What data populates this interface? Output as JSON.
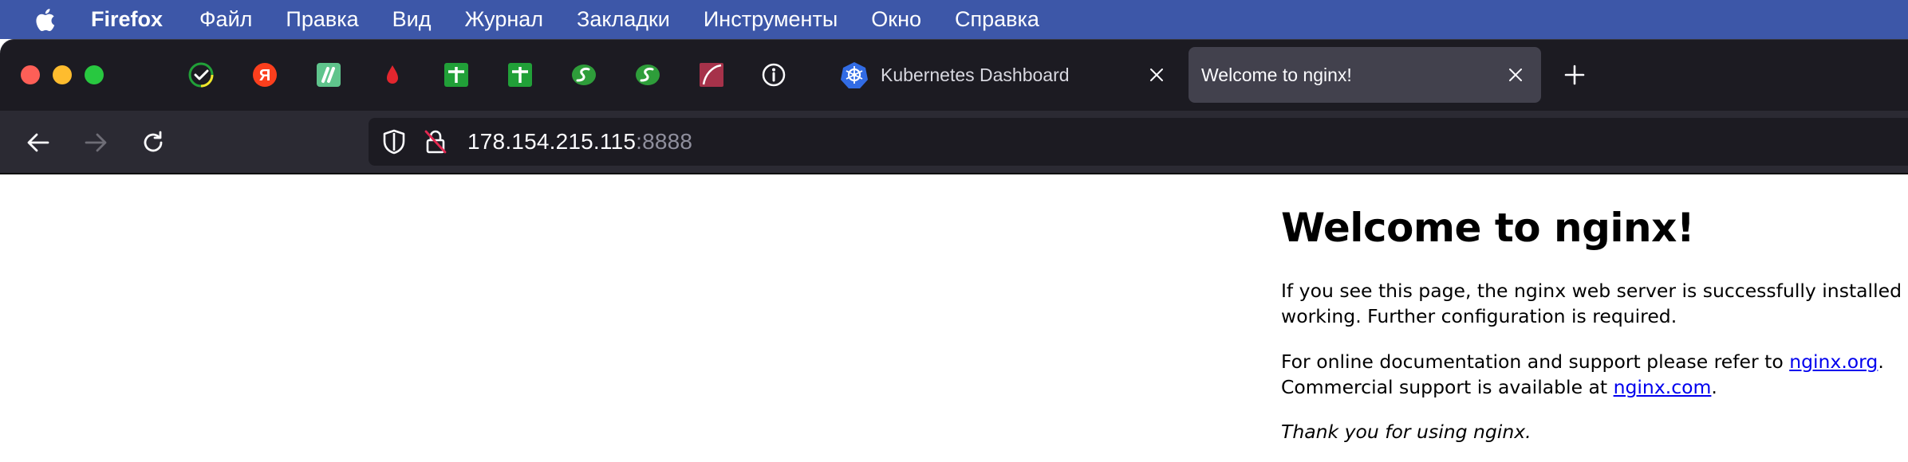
{
  "menubar": {
    "apple_icon": "apple-logo-icon",
    "app_name": "Firefox",
    "items": [
      "Файл",
      "Правка",
      "Вид",
      "Журнал",
      "Закладки",
      "Инструменты",
      "Окно",
      "Справка"
    ]
  },
  "tabbar": {
    "pinned_tabs": [
      {
        "icon": "sber-checkmark-icon",
        "color": "#21a038"
      },
      {
        "icon": "yandex-icon",
        "color": "#fc3f1d"
      },
      {
        "icon": "green-square-app-icon",
        "color": "#5fc48c"
      },
      {
        "icon": "red-drop-icon",
        "color": "#e3262e"
      },
      {
        "icon": "green-table-plus-icon",
        "color": "#21a038"
      },
      {
        "icon": "green-table-plus-icon",
        "color": "#21a038"
      },
      {
        "icon": "green-swirl-s-icon",
        "color": "#2e9d3a"
      },
      {
        "icon": "green-swirl-s-icon",
        "color": "#2e9d3a"
      },
      {
        "icon": "red-feather-icon",
        "color": "#a6324a"
      },
      {
        "icon": "info-circle-icon",
        "color": "#fbfbfe"
      }
    ],
    "tabs": [
      {
        "title": "Kubernetes Dashboard",
        "favicon": "kubernetes-icon",
        "active": false
      },
      {
        "title": "Welcome to nginx!",
        "active": true
      }
    ],
    "new_tab_icon": "plus-icon"
  },
  "navbar": {
    "back_icon": "arrow-left-icon",
    "forward_icon": "arrow-right-icon",
    "reload_icon": "reload-icon",
    "url_host": "178.154.215.115",
    "url_port": ":8888"
  },
  "page": {
    "heading": "Welcome to nginx!",
    "p1_line1": "If you see this page, the nginx web server is successfully installed and",
    "p1_line2": "working. Further configuration is required.",
    "p2_line1_prefix": "For online documentation and support please refer to ",
    "p2_link1": "nginx.org",
    "p2_line1_suffix": ".",
    "p2_line2_prefix": "Commercial support is available at ",
    "p2_link2": "nginx.com",
    "p2_line2_suffix": ".",
    "p3": "Thank you for using nginx."
  },
  "colors": {
    "menubar_bg": "#3d57a8",
    "tabbar_bg": "#1c1b22",
    "active_tab_bg": "#42414d",
    "navbar_bg": "#2b2a33",
    "link": "#0000ee"
  }
}
